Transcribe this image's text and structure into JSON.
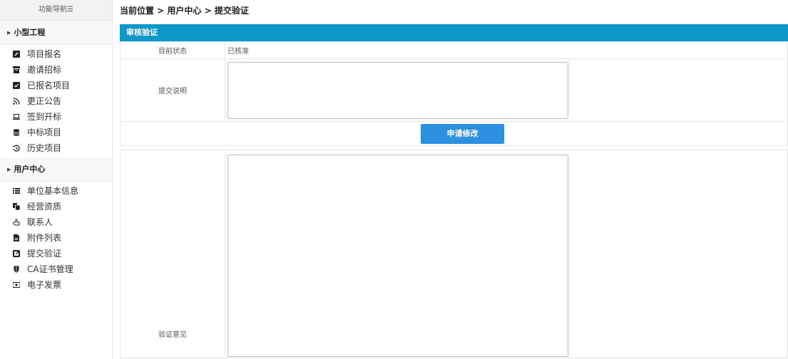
{
  "sidebar": {
    "header": "功能导航☰",
    "groups": [
      {
        "title": "小型工程",
        "items": [
          {
            "label": "项目报名",
            "icon": "edit-icon"
          },
          {
            "label": "邀请招标",
            "icon": "archive-icon"
          },
          {
            "label": "已报名项目",
            "icon": "check-square-icon"
          },
          {
            "label": "更正公告",
            "icon": "rss-icon"
          },
          {
            "label": "签到开标",
            "icon": "laptop-icon"
          },
          {
            "label": "中标项目",
            "icon": "database-icon"
          },
          {
            "label": "历史项目",
            "icon": "history-icon"
          }
        ]
      },
      {
        "title": "用户中心",
        "items": [
          {
            "label": "单位基本信息",
            "icon": "list-icon"
          },
          {
            "label": "经营资质",
            "icon": "copy-icon"
          },
          {
            "label": "联系人",
            "icon": "hand-point-icon"
          },
          {
            "label": "附件列表",
            "icon": "file-icon"
          },
          {
            "label": "提交验证",
            "icon": "external-link-icon"
          },
          {
            "label": "CA证书管理",
            "icon": "shield-icon"
          },
          {
            "label": "电子发票",
            "icon": "money-icon"
          }
        ]
      }
    ]
  },
  "breadcrumb": "当前位置 > 用户中心 > 提交验证",
  "panel": {
    "title": "审核验证",
    "status_label": "目前状态",
    "status_value": "已核准",
    "description_label": "提交说明",
    "description_value": "",
    "apply_button": "申请修改",
    "opinion_label": "验证意见",
    "opinion_value": ""
  },
  "colors": {
    "panel_header": "#0d98c9",
    "button": "#2d8fe0"
  }
}
